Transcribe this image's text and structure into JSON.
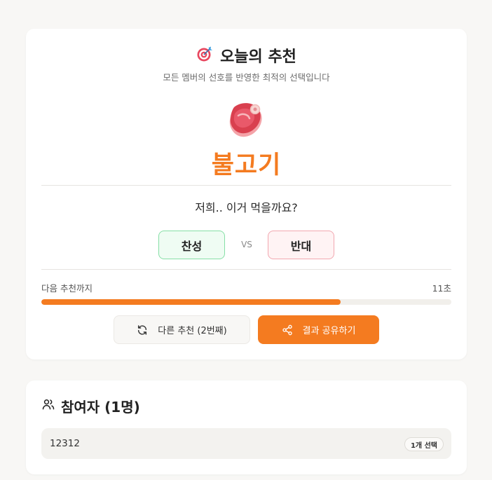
{
  "recommendation": {
    "title": "오늘의 추천",
    "title_icon": "target-icon",
    "subtitle": "모든 멤버의 선호를 반영한 최적의 선택입니다",
    "food_icon": "meat-icon",
    "food_name": "불고기",
    "question": "저희.. 이거 먹을까요?",
    "agree_label": "찬성",
    "vs_label": "VS",
    "disagree_label": "반대",
    "next_label": "다음 추천까지",
    "next_time": "11초",
    "progress_fraction": 0.73,
    "other_button_label": "다른 추천 (2번째)",
    "share_button_label": "결과 공유하기",
    "accent_color": "#f47b20"
  },
  "participants": {
    "title": "참여자 (1명)",
    "title_icon": "users-icon",
    "items": [
      {
        "name": "12312",
        "badge": "1개 선택"
      }
    ]
  }
}
